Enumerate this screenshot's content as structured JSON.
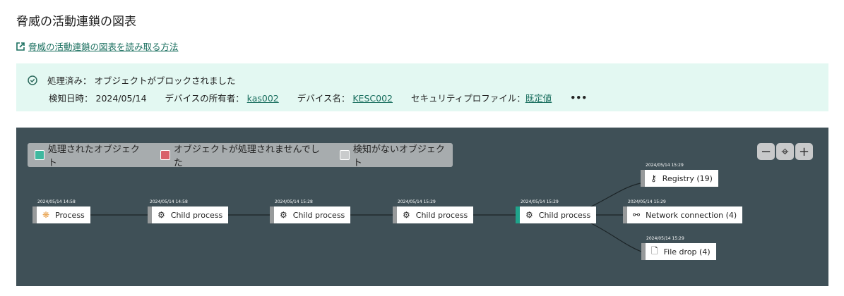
{
  "title": "脅威の活動連鎖の図表",
  "help_link": "脅威の活動連鎖の図表を読み取る方法",
  "status": {
    "state": "処理済み：",
    "message": "オブジェクトがブロックされました",
    "detected_label": "検知日時：",
    "detected": "2024/05/14",
    "owner_label": "デバイスの所有者：",
    "owner": "kas002",
    "device_label": "デバイス名：",
    "device": "KESC002",
    "profile_label": "セキュリティプロファイル：",
    "profile": "既定値",
    "more": "•••"
  },
  "legend": [
    {
      "label": "処理されたオブジェクト",
      "color": "#3fb89f"
    },
    {
      "label": "オブジェクトが処理されませんでした",
      "color": "#d9606a"
    },
    {
      "label": "検知がないオブジェクト",
      "color": "#c9cbcc"
    }
  ],
  "zoom": {
    "out": "−",
    "center": "⌖",
    "in": "+"
  },
  "nodes": [
    {
      "label": "Process",
      "time": "2024/05/14 14:58",
      "icon": "process-icon"
    },
    {
      "label": "Child process",
      "time": "2024/05/14 14:58",
      "icon": "gear-icon"
    },
    {
      "label": "Child process",
      "time": "2024/05/14 15:28",
      "icon": "gear-icon"
    },
    {
      "label": "Child process",
      "time": "2024/05/14 15:29",
      "icon": "gear-icon"
    },
    {
      "label": "Child process",
      "time": "2024/05/14 15:29",
      "icon": "gear-icon"
    },
    {
      "label": "Registry (19)",
      "time": "2024/05/14 15:29",
      "icon": "key-icon"
    },
    {
      "label": "Network connection (4)",
      "time": "2024/05/14 15:29",
      "icon": "plug-icon"
    },
    {
      "label": "File drop (4)",
      "time": "2024/05/14 15:29",
      "icon": "file-icon"
    }
  ]
}
